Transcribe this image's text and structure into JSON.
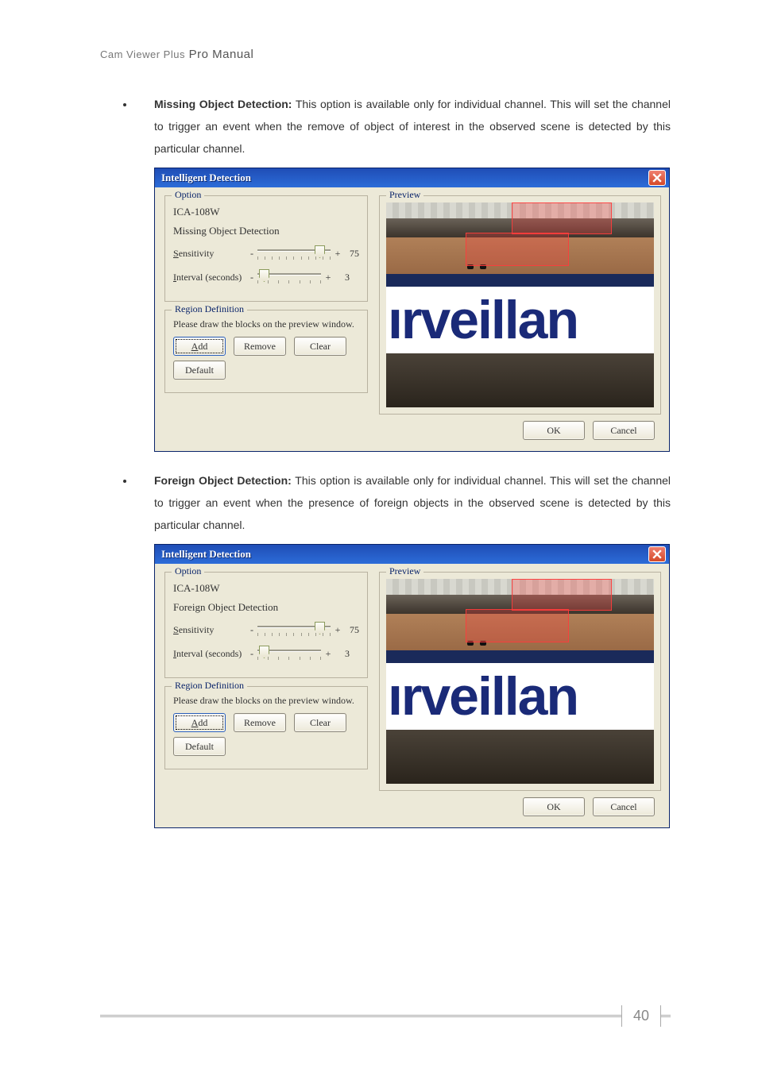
{
  "doc": {
    "header_light": "Cam Viewer Plus",
    "header_strong": "Pro Manual",
    "page_number": "40"
  },
  "section1": {
    "title": "Missing Object Detection:",
    "body": " This option is available only for individual channel. This will set the channel to trigger an event when the remove of object of interest in the observed scene is detected by this particular channel."
  },
  "section2": {
    "title": "Foreign Object Detection:",
    "body": " This option is available only for individual channel. This will set the channel to trigger an event when the presence of foreign objects in the observed scene is detected by this particular channel."
  },
  "dialog1": {
    "title": "Intelligent Detection",
    "option_legend": "Option",
    "camera": "ICA-108W",
    "mode": "Missing Object Detection",
    "sensitivity_label": "Sensitivity",
    "sensitivity_value": "75",
    "interval_label": "Interval (seconds)",
    "interval_value": "3",
    "plus": "+",
    "dash": "-",
    "region_legend": "Region Definition",
    "region_text": "Please draw the blocks on the preview window.",
    "add": "Add",
    "remove": "Remove",
    "clear": "Clear",
    "default": "Default",
    "preview_legend": "Preview",
    "banner_text": "ırveillan",
    "ok": "OK",
    "cancel": "Cancel"
  },
  "dialog2": {
    "title": "Intelligent Detection",
    "option_legend": "Option",
    "camera": "ICA-108W",
    "mode": "Foreign Object Detection",
    "sensitivity_label": "Sensitivity",
    "sensitivity_value": "75",
    "interval_label": "Interval (seconds)",
    "interval_value": "3",
    "plus": "+",
    "dash": "-",
    "region_legend": "Region Definition",
    "region_text": "Please draw the blocks on the preview window.",
    "add": "Add",
    "remove": "Remove",
    "clear": "Clear",
    "default": "Default",
    "preview_legend": "Preview",
    "banner_text": "ırveillan",
    "ok": "OK",
    "cancel": "Cancel"
  }
}
